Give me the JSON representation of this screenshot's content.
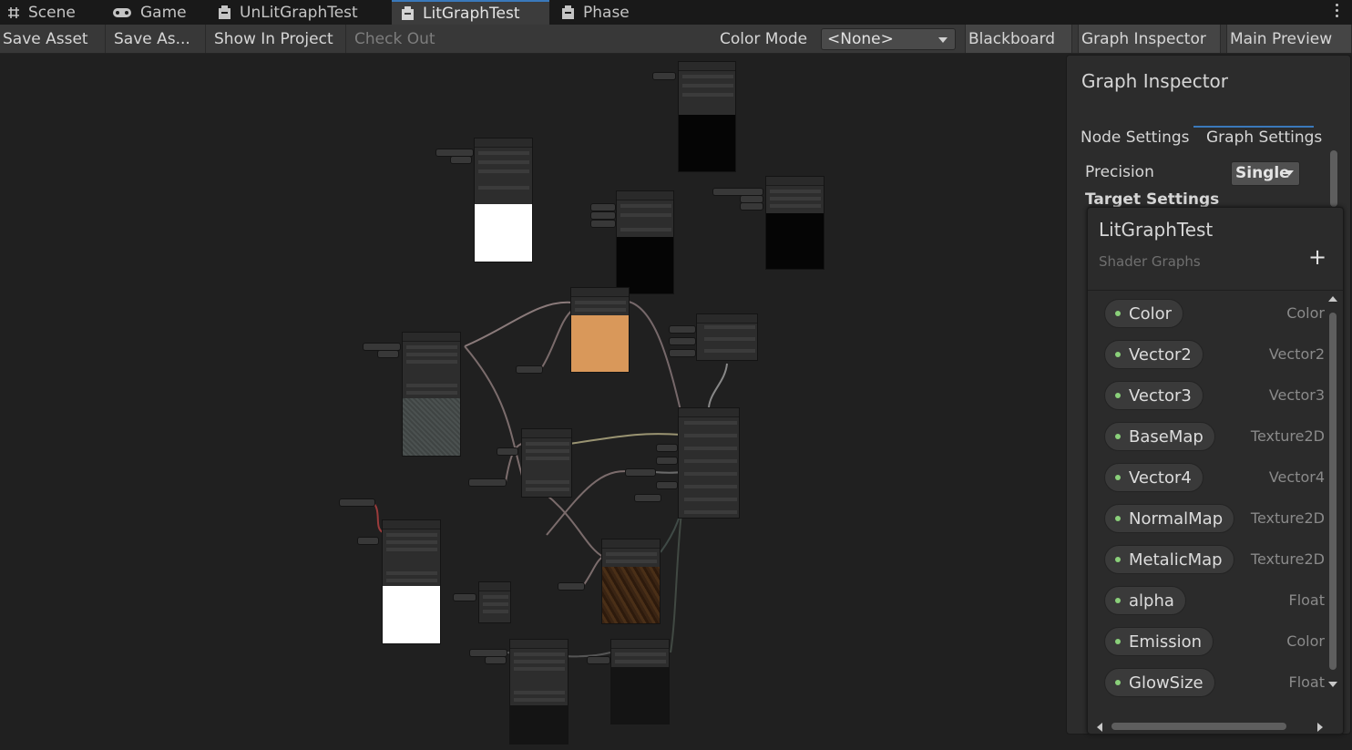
{
  "tabs": [
    {
      "label": "Scene",
      "icon": "grid-hash-icon",
      "active": false
    },
    {
      "label": "Game",
      "icon": "gamepad-icon",
      "active": false
    },
    {
      "label": "UnLitGraphTest",
      "icon": "shader-graph-icon",
      "active": false
    },
    {
      "label": "LitGraphTest",
      "icon": "shader-graph-icon",
      "active": true
    },
    {
      "label": "Phase",
      "icon": "shader-graph-icon",
      "active": false
    }
  ],
  "toolbar": {
    "save_asset": "Save Asset",
    "save_as": "Save As...",
    "show_in_project": "Show In Project",
    "check_out": "Check Out",
    "color_mode_label": "Color Mode",
    "color_mode_value": "<None>",
    "blackboard": "Blackboard",
    "graph_inspector": "Graph Inspector",
    "main_preview": "Main Preview"
  },
  "inspector": {
    "title": "Graph Inspector",
    "tab_node": "Node Settings",
    "tab_graph": "Graph Settings",
    "precision_label": "Precision",
    "precision_value": "Single",
    "target_settings": "Target Settings"
  },
  "blackboard": {
    "title": "LitGraphTest",
    "subtitle": "Shader Graphs",
    "add": "+",
    "properties": [
      {
        "name": "Color",
        "type": "Color"
      },
      {
        "name": "Vector2",
        "type": "Vector2"
      },
      {
        "name": "Vector3",
        "type": "Vector3"
      },
      {
        "name": "BaseMap",
        "type": "Texture2D"
      },
      {
        "name": "Vector4",
        "type": "Vector4"
      },
      {
        "name": "NormalMap",
        "type": "Texture2D"
      },
      {
        "name": "MetalicMap",
        "type": "Texture2D"
      },
      {
        "name": "alpha",
        "type": "Float"
      },
      {
        "name": "Emission",
        "type": "Color"
      },
      {
        "name": "GlowSize",
        "type": "Float"
      }
    ]
  },
  "colors": {
    "accent": "#3a79bb",
    "canvas": "#202020",
    "property_dot": "#8ad07a",
    "preview_orange": "#d9985a"
  }
}
